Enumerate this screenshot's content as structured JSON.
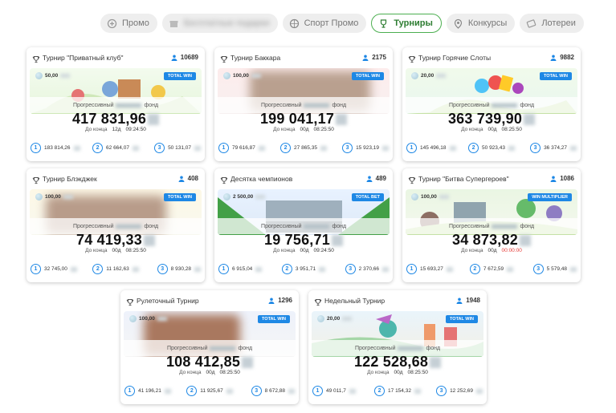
{
  "tabs": [
    {
      "label": "Промо",
      "icon": "promo-icon"
    },
    {
      "label": "Бесплатные подарки",
      "icon": "gift-icon"
    },
    {
      "label": "Спорт Промо",
      "icon": "sport-icon"
    },
    {
      "label": "Турниры",
      "icon": "trophy-icon",
      "active": true
    },
    {
      "label": "Конкурсы",
      "icon": "contest-icon"
    },
    {
      "label": "Лотереи",
      "icon": "lottery-icon"
    }
  ],
  "common": {
    "fund_prefix": "Прогрессивный",
    "fund_suffix": "фонд",
    "until_end": "До конца"
  },
  "cards": [
    {
      "title": "Турнир \"Приватный клуб\"",
      "players": "10689",
      "entry": "50,00",
      "badge": "TOTAL WIN",
      "amount": "417 831,96",
      "days": "12д",
      "time": "09:24:50",
      "prizes": [
        "183 814,26",
        "62 664,07",
        "50 131,07"
      ]
    },
    {
      "title": "Турнир Баккара",
      "players": "2175",
      "entry": "100,00",
      "badge": "TOTAL WIN",
      "amount": "199 041,17",
      "days": "00д",
      "time": "08:25:50",
      "prizes": [
        "79 616,87",
        "27 865,35",
        "15 923,19"
      ]
    },
    {
      "title": "Турнир Горячие Слоты",
      "players": "9882",
      "entry": "20,00",
      "badge": "TOTAL WIN",
      "amount": "363 739,90",
      "days": "00д",
      "time": "08:25:50",
      "prizes": [
        "145 496,18",
        "50 923,43",
        "36 374,27"
      ]
    },
    {
      "title": "Турнир Блэкджек",
      "players": "408",
      "entry": "100,00",
      "badge": "TOTAL WIN",
      "amount": "74 419,33",
      "days": "00д",
      "time": "08:25:50",
      "prizes": [
        "32 745,00",
        "11 162,63",
        "8 930,28"
      ]
    },
    {
      "title": "Десятка чемпионов",
      "players": "489",
      "entry": "2 500,00",
      "badge": "TOTAL BET",
      "amount": "19 756,71",
      "days": "00д",
      "time": "09:24:50",
      "prizes": [
        "6 915,04",
        "3 951,71",
        "2 370,66"
      ]
    },
    {
      "title": "Турнир \"Битва Супергероев\"",
      "players": "1086",
      "entry": "100,00",
      "badge": "WIN MULTIPLIER",
      "amount": "34 873,82",
      "days": "00д",
      "time": "00:00:00",
      "prizes": [
        "15 693,27",
        "7 672,59",
        "5 579,48"
      ]
    },
    {
      "title": "Рулеточный Турнир",
      "players": "1296",
      "entry": "100,00",
      "badge": "TOTAL WIN",
      "amount": "108 412,85",
      "days": "00д",
      "time": "08:25:50",
      "prizes": [
        "41 196,21",
        "11 925,67",
        "8 672,88"
      ]
    },
    {
      "title": "Недельный Турнир",
      "players": "1948",
      "entry": "20,00",
      "badge": "TOTAL WIN",
      "amount": "122 528,68",
      "days": "00д",
      "time": "08:25:50",
      "prizes": [
        "49 011,7",
        "17 154,32",
        "12 252,69"
      ]
    }
  ]
}
